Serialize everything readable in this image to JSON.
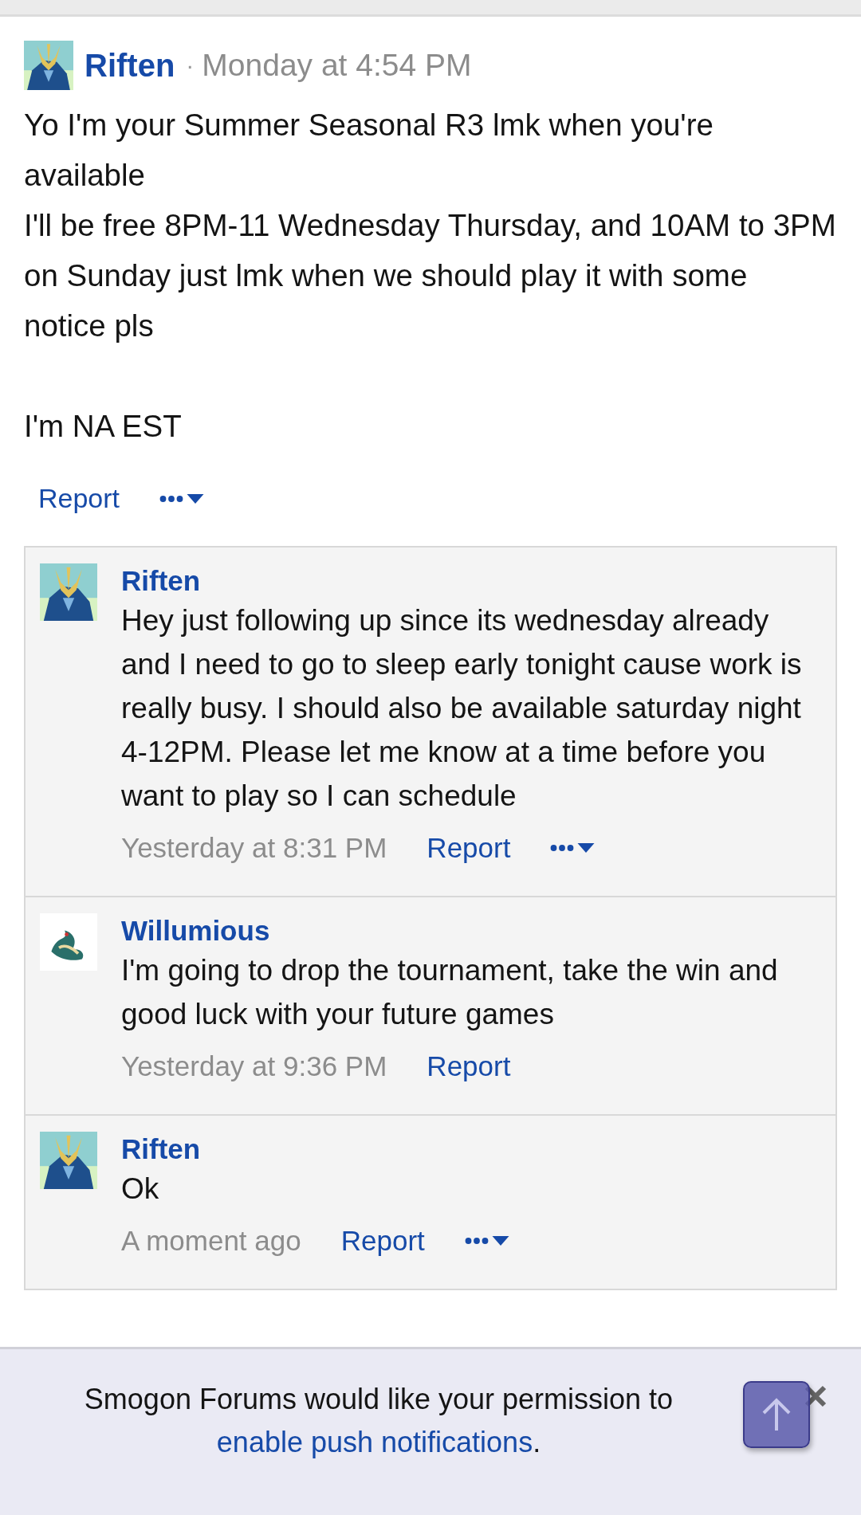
{
  "post": {
    "author": "Riften",
    "separator": "·",
    "time": "Monday at 4:54 PM",
    "avatar": {
      "kind": "knight"
    },
    "body": "Yo I'm your Summer Seasonal R3 lmk when you're available\nI'll be free 8PM-11 Wednesday Thursday, and 10AM to 3PM on Sunday just lmk when we should play it with some notice pls\n\nI'm NA EST",
    "report": "Report",
    "more_menu": true
  },
  "comments": [
    {
      "author": "Riften",
      "avatar": {
        "kind": "knight"
      },
      "text": "Hey just following up since its wednesday already and I need to go to sleep early tonight cause work is really busy. I should also be available saturday night 4-12PM. Please let me know at a time before you want to play so I can schedule",
      "time": "Yesterday at 8:31 PM",
      "report": "Report",
      "more_menu": true
    },
    {
      "author": "Willumious",
      "avatar": {
        "kind": "serpent"
      },
      "text": "I'm going to drop the tournament, take the win and good luck with your future games",
      "time": "Yesterday at 9:36 PM",
      "report": "Report",
      "more_menu": false
    },
    {
      "author": "Riften",
      "avatar": {
        "kind": "knight"
      },
      "text": "Ok",
      "time": "A moment ago",
      "report": "Report",
      "more_menu": true
    }
  ],
  "push_banner": {
    "text": "Smogon Forums would like your permission to ",
    "link": "enable push notifications",
    "end": "."
  }
}
